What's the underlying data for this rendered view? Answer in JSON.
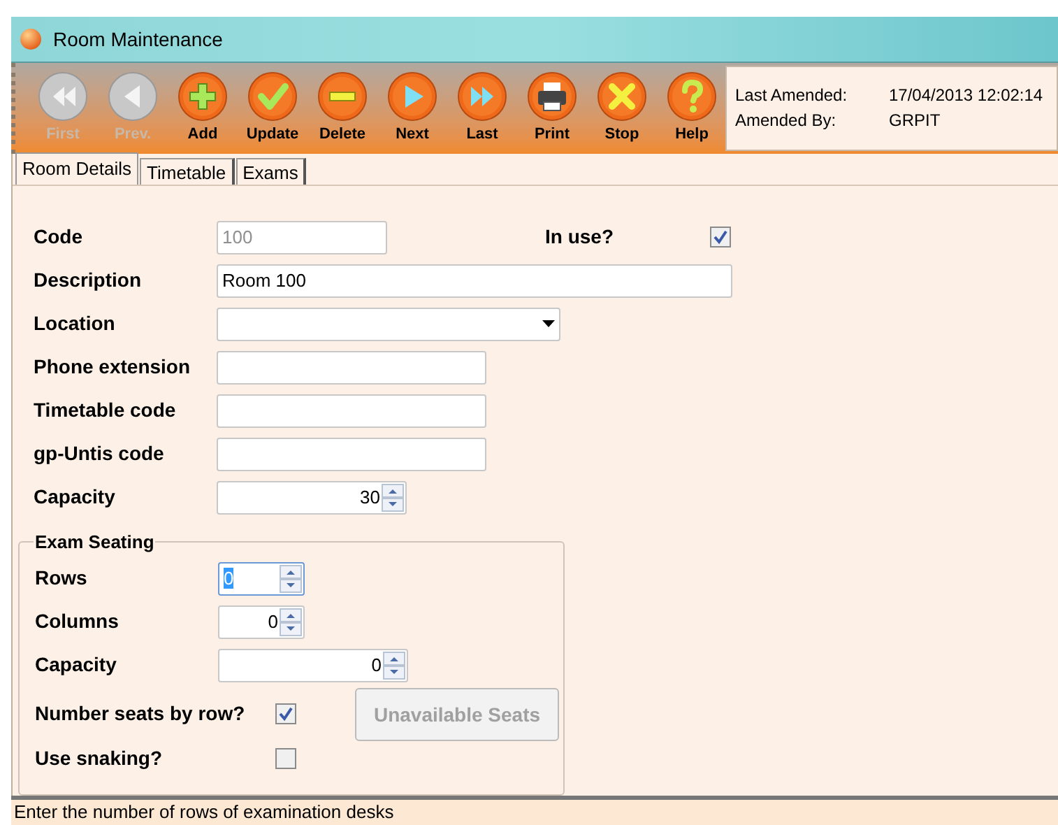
{
  "window": {
    "title": "Room Maintenance"
  },
  "toolbar": [
    {
      "label": "First",
      "kind": "first",
      "disabled": true
    },
    {
      "label": "Prev.",
      "kind": "prev",
      "disabled": true
    },
    {
      "label": "Add",
      "kind": "add",
      "disabled": false
    },
    {
      "label": "Update",
      "kind": "update",
      "disabled": false
    },
    {
      "label": "Delete",
      "kind": "delete",
      "disabled": false
    },
    {
      "label": "Next",
      "kind": "next",
      "disabled": false
    },
    {
      "label": "Last",
      "kind": "last",
      "disabled": false
    },
    {
      "label": "Print",
      "kind": "print",
      "disabled": false
    },
    {
      "label": "Stop",
      "kind": "stop",
      "disabled": false
    },
    {
      "label": "Help",
      "kind": "help",
      "disabled": false
    }
  ],
  "amended": {
    "last_amended_label": "Last Amended:",
    "last_amended": "17/04/2013 12:02:14",
    "amended_by_label": "Amended By:",
    "amended_by": "GRPIT"
  },
  "tabs": [
    {
      "label": "Room Details",
      "selected": true
    },
    {
      "label": "Timetable",
      "selected": false
    },
    {
      "label": "Exams",
      "selected": false
    }
  ],
  "fields": [
    {
      "label": "Code",
      "kind": "short",
      "value": "100",
      "disabled": true
    },
    {
      "label": "Description",
      "kind": "wide",
      "value": "Room 100"
    },
    {
      "label": "Location",
      "kind": "dropdown"
    },
    {
      "label": "Phone extension",
      "kind": "text"
    },
    {
      "label": "Timetable code",
      "kind": "text"
    },
    {
      "label": "gp-Untis code",
      "kind": "text"
    },
    {
      "label": "Capacity",
      "kind": "spin",
      "value": "30"
    }
  ],
  "in_use": {
    "label": "In use?",
    "checked": true
  },
  "exam_seating": {
    "title": "Exam Seating",
    "fields": [
      {
        "label": "Rows",
        "value": "0",
        "kind": "small",
        "focused": true
      },
      {
        "label": "Columns",
        "value": "0",
        "kind": "small",
        "focused": false
      },
      {
        "label": "Capacity",
        "value": "0",
        "kind": "medium",
        "focused": false
      }
    ],
    "checks": [
      {
        "label": "Number seats by row?",
        "checked": true
      },
      {
        "label": "Use snaking?",
        "checked": false
      }
    ],
    "button": {
      "label": "Unavailable Seats",
      "disabled": true
    }
  },
  "status_bar": "Enter the number of rows of examination desks"
}
